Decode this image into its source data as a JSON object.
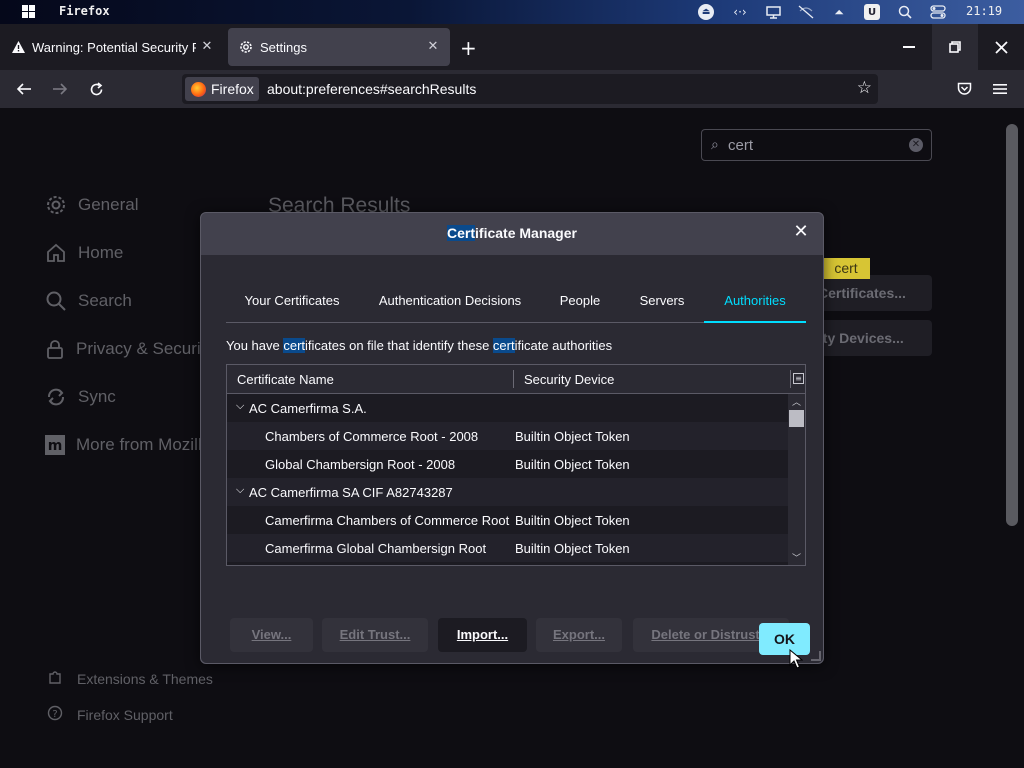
{
  "os": {
    "app_title": "Firefox",
    "clock": "21:19",
    "tray_icons": [
      "eject-icon",
      "code-icon",
      "monitor-icon",
      "network-off-icon",
      "upload-icon",
      "u-app-icon",
      "search-icon",
      "toggle-icon"
    ]
  },
  "tabs": [
    {
      "label": "Warning: Potential Security Risk Ahead",
      "icon": "warning-icon",
      "active": false
    },
    {
      "label": "Settings",
      "icon": "gear-icon",
      "active": true
    }
  ],
  "nav": {
    "identity_label": "Firefox",
    "url": "about:preferences#searchResults"
  },
  "search": {
    "value": "cert"
  },
  "sidebar": {
    "items": [
      {
        "label": "General",
        "icon": "gear-icon"
      },
      {
        "label": "Home",
        "icon": "home-icon"
      },
      {
        "label": "Search",
        "icon": "search-icon"
      },
      {
        "label": "Privacy & Security",
        "icon": "lock-icon"
      },
      {
        "label": "Sync",
        "icon": "sync-icon"
      },
      {
        "label": "More from Mozilla",
        "icon": "mozilla-icon"
      }
    ],
    "footer": [
      {
        "label": "Extensions & Themes",
        "icon": "puzzle-icon"
      },
      {
        "label": "Firefox Support",
        "icon": "help-icon"
      }
    ]
  },
  "main": {
    "results_title": "Search Results",
    "bg_button_certificates": "Certificates...",
    "bg_button_devices": "Security Devices...",
    "tooltip": "cert"
  },
  "dialog": {
    "title_highlight": "Cert",
    "title_rest": "ificate Manager",
    "tabs": [
      "Your Certificates",
      "Authentication Decisions",
      "People",
      "Servers",
      "Authorities"
    ],
    "selected_tab": "Authorities",
    "desc_1": "You have ",
    "desc_hl_1": "cert",
    "desc_2": "ificates on file that identify these ",
    "desc_hl_2": "cert",
    "desc_3": "ificate authorities",
    "columns": [
      "Certificate Name",
      "Security Device"
    ],
    "rows": [
      {
        "name": "AC Camerfirma S.A.",
        "device": "",
        "group": true
      },
      {
        "name": "Chambers of Commerce Root - 2008",
        "device": "Builtin Object Token",
        "group": false
      },
      {
        "name": "Global Chambersign Root - 2008",
        "device": "Builtin Object Token",
        "group": false
      },
      {
        "name": "AC Camerfirma SA CIF A82743287",
        "device": "",
        "group": true
      },
      {
        "name": "Camerfirma Chambers of Commerce Root",
        "device": "Builtin Object Token",
        "group": false
      },
      {
        "name": "Camerfirma Global Chambersign Root",
        "device": "Builtin Object Token",
        "group": false
      }
    ],
    "buttons": {
      "view": "View...",
      "edit_trust": "Edit Trust...",
      "import": "Import...",
      "export": "Export...",
      "delete": "Delete or Distrust..."
    },
    "ok": "OK"
  }
}
